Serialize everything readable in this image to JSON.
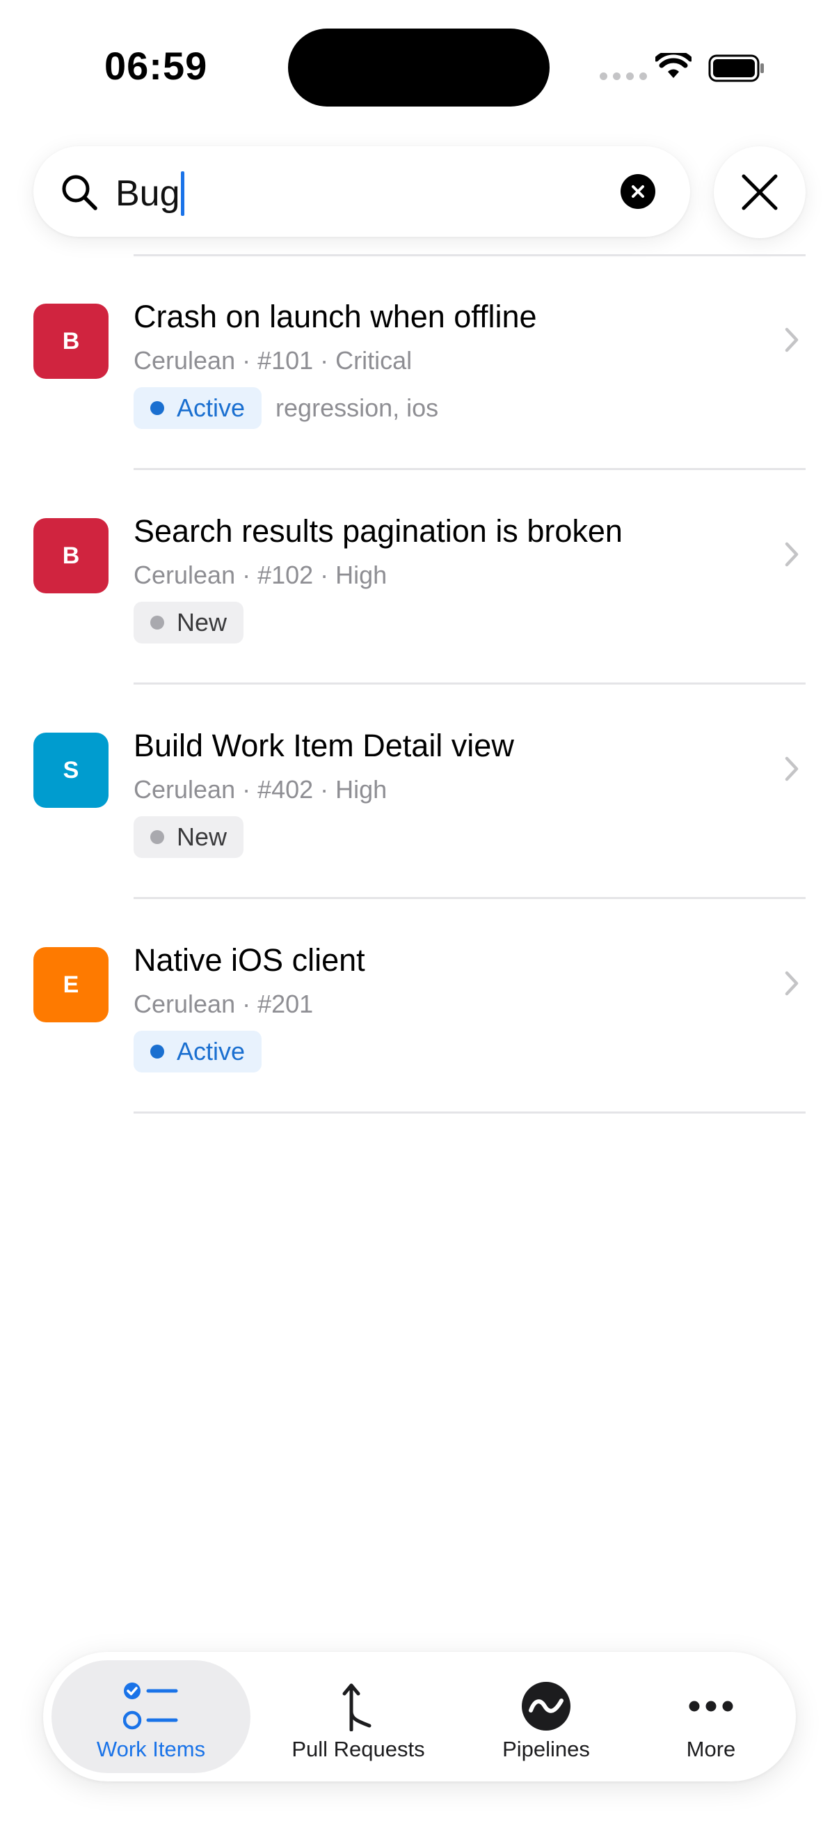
{
  "status_bar": {
    "time": "06:59"
  },
  "search": {
    "value": "Bug"
  },
  "colors": {
    "accent": "#1a73e8",
    "active_badge_bg": "#e8f2fd",
    "active_badge_text": "#1a6fd0",
    "new_badge_bg": "#efeff1",
    "new_badge_text": "#3a3a3c",
    "new_dot": "#a9a9ae"
  },
  "work_items": [
    {
      "avatar_letter": "B",
      "avatar_color": "#d0243f",
      "title": "Crash on launch when offline",
      "meta": "Cerulean · #101 · Critical",
      "status": "Active",
      "tags": "regression, ios"
    },
    {
      "avatar_letter": "B",
      "avatar_color": "#d0243f",
      "title": "Search results pagination is broken",
      "meta": "Cerulean · #102 · High",
      "status": "New",
      "tags": ""
    },
    {
      "avatar_letter": "S",
      "avatar_color": "#009ccf",
      "title": "Build Work Item Detail view",
      "meta": "Cerulean · #402 · High",
      "status": "New",
      "tags": ""
    },
    {
      "avatar_letter": "E",
      "avatar_color": "#fe7a00",
      "title": "Native iOS client",
      "meta": "Cerulean · #201",
      "status": "Active",
      "tags": ""
    }
  ],
  "tab_bar": {
    "tabs": [
      {
        "label": "Work Items",
        "icon": "work-items-icon",
        "selected": true
      },
      {
        "label": "Pull Requests",
        "icon": "pull-request-icon",
        "selected": false
      },
      {
        "label": "Pipelines",
        "icon": "pipelines-icon",
        "selected": false
      },
      {
        "label": "More",
        "icon": "more-icon",
        "selected": false
      }
    ]
  }
}
